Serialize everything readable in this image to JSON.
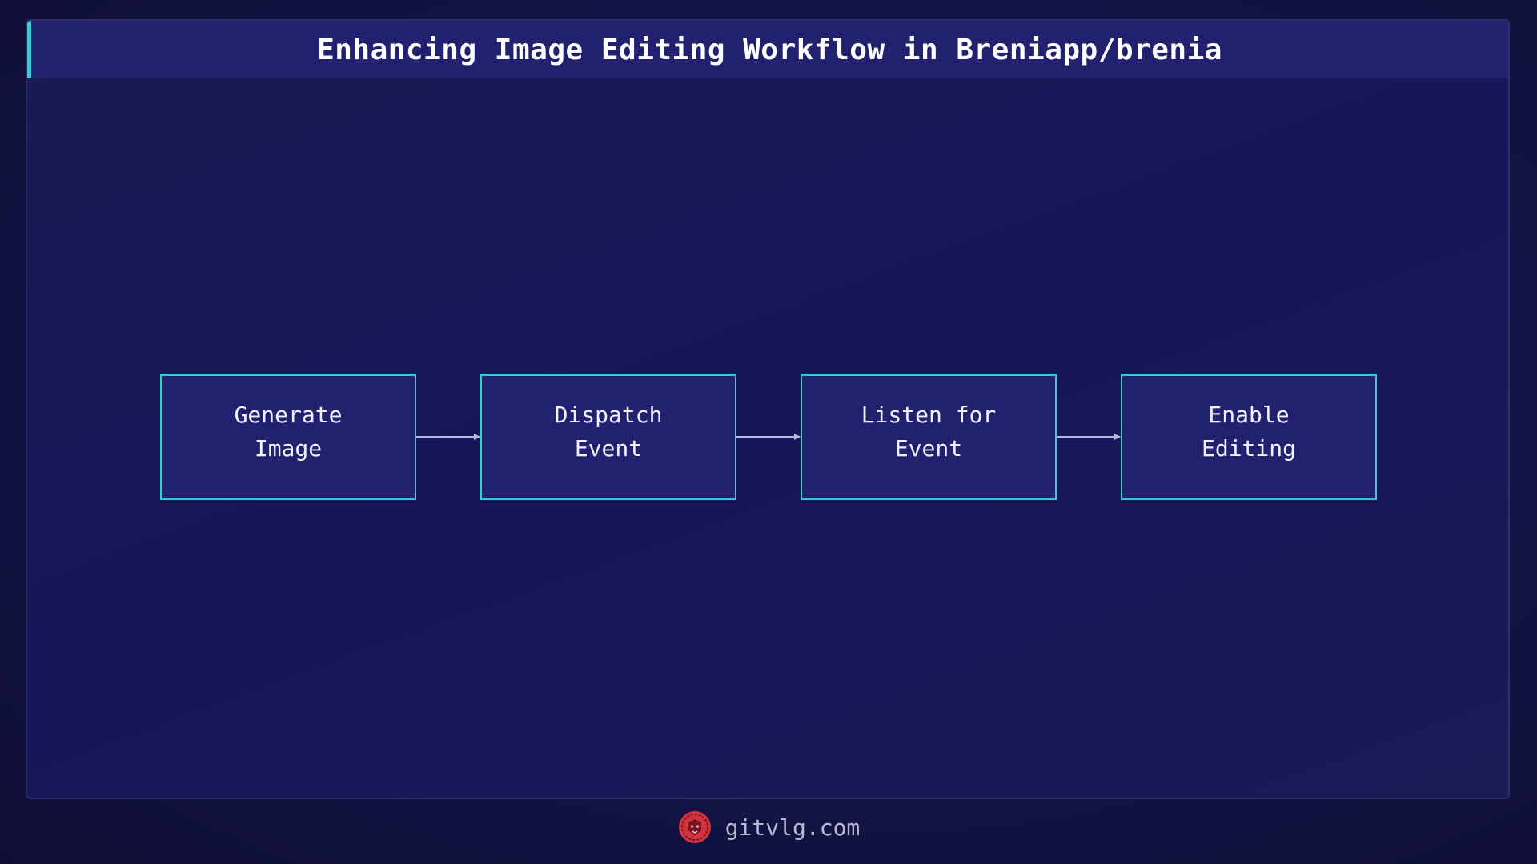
{
  "title": "Enhancing Image Editing Workflow in Breniapp/brenia",
  "diagram": {
    "nodes": [
      {
        "id": "generate-image",
        "label": "Generate\nImage"
      },
      {
        "id": "dispatch-event",
        "label": "Dispatch\nEvent"
      },
      {
        "id": "listen-for-event",
        "label": "Listen for\nEvent"
      },
      {
        "id": "enable-editing",
        "label": "Enable\nEditing"
      }
    ],
    "edges": [
      {
        "from": "generate-image",
        "to": "dispatch-event"
      },
      {
        "from": "dispatch-event",
        "to": "listen-for-event"
      },
      {
        "from": "listen-for-event",
        "to": "enable-editing"
      }
    ]
  },
  "footer": {
    "logo_icon": "lion-logo-icon",
    "site": "gitvlg.com"
  },
  "colors": {
    "node_border": "#3fc7d0",
    "node_fill": "#22216f",
    "arrow": "#b8b8d8",
    "logo": "#d2343f"
  }
}
